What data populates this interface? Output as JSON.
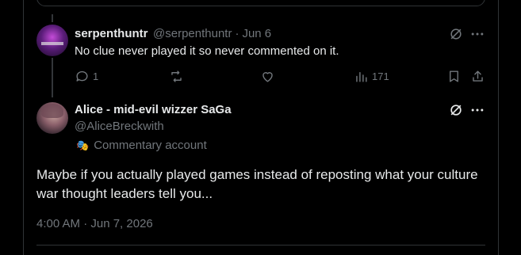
{
  "reply1": {
    "display_name": "serpenthuntr",
    "handle": "@serpenthuntr",
    "separator": "·",
    "date": "Jun 6",
    "text": "No clue never played it so never commented on it.",
    "actions": {
      "reply_count": "1",
      "repost_count": "",
      "like_count": "",
      "view_count": "171"
    }
  },
  "main_post": {
    "display_name": "Alice - mid-evil wizzer SaGa",
    "handle": "@AliceBreckwith",
    "account_label_icon": "theater-mask-icon",
    "account_label": "Commentary account",
    "text": "Maybe if you actually played games instead of reposting what your culture war thought leaders tell you...",
    "timestamp": "4:00 AM · Jun 7, 2026"
  },
  "colors": {
    "background": "#000000",
    "text_primary": "#e7e9ea",
    "text_secondary": "#71767b",
    "border": "#2f3336"
  }
}
